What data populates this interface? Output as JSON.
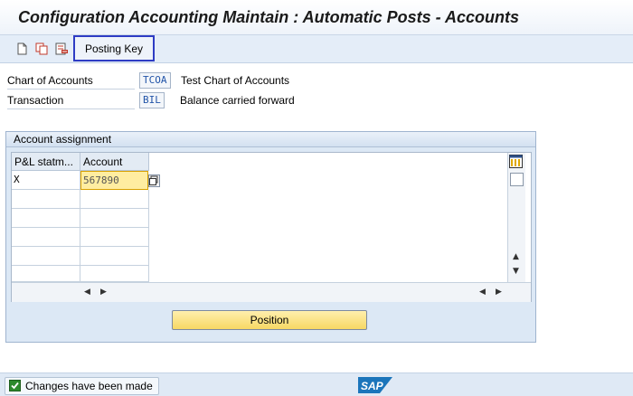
{
  "window": {
    "title": "Configuration Accounting Maintain : Automatic Posts - Accounts"
  },
  "toolbar": {
    "icons": [
      "new-document-icon",
      "copy-icon",
      "delete-icon"
    ],
    "posting_key_label": "Posting Key"
  },
  "header_fields": [
    {
      "label": "Chart of Accounts",
      "value": "TCOA",
      "description": "Test Chart of Accounts"
    },
    {
      "label": "Transaction",
      "value": "BIL",
      "description": "Balance carried forward"
    }
  ],
  "account_assignment": {
    "title": "Account assignment",
    "columns": [
      "P&L statm...",
      "Account"
    ],
    "rows": [
      {
        "pl_statement": "X",
        "account": "567890"
      }
    ],
    "empty_row_count": 5
  },
  "buttons": {
    "position_label": "Position"
  },
  "status": {
    "message": "Changes have been made"
  },
  "brand": {
    "logo": "SAP",
    "accent": "#2e3cc4"
  }
}
